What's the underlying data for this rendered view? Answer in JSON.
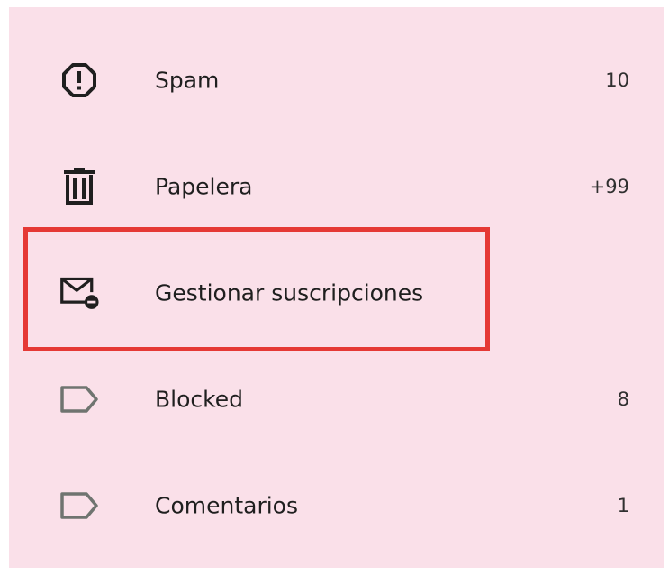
{
  "menu": {
    "items": [
      {
        "label": "Spam",
        "count": "10",
        "icon": "spam-report-icon"
      },
      {
        "label": "Papelera",
        "count": "+99",
        "icon": "trash-icon"
      },
      {
        "label": "Gestionar suscripciones",
        "count": "",
        "icon": "manage-subscriptions-icon"
      },
      {
        "label": "Blocked",
        "count": "8",
        "icon": "label-icon"
      },
      {
        "label": "Comentarios",
        "count": "1",
        "icon": "label-icon"
      }
    ]
  },
  "colors": {
    "background": "#fae0e9",
    "highlight": "#e53935",
    "icon": "#1f1f1f",
    "label_icon": "#6f7470"
  }
}
